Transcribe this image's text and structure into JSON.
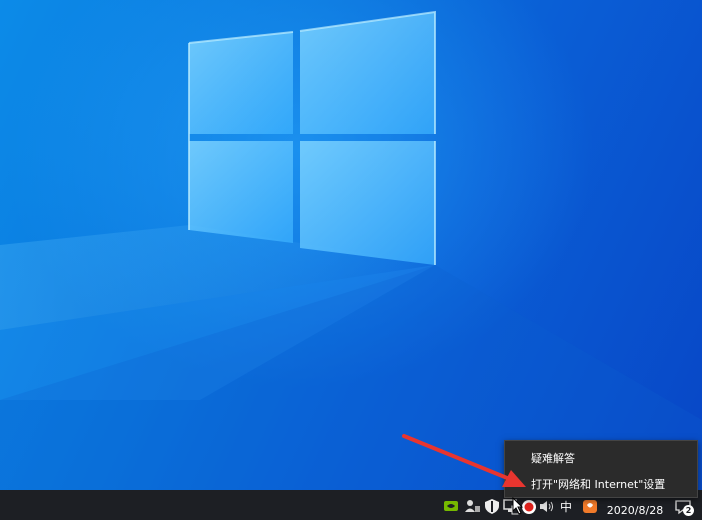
{
  "context_menu": {
    "items": [
      {
        "label": "疑难解答"
      },
      {
        "label": "打开\"网络和 Internet\"设置"
      }
    ]
  },
  "taskbar": {
    "ime_label": "中",
    "date": "2020/8/28",
    "notification_count": "2"
  },
  "tray_icons": [
    "nvidia-icon",
    "network-user-icon",
    "security-shield-icon",
    "network-icon",
    "record-icon",
    "volume-icon",
    "ime-icon",
    "app-icon",
    "notification-icon"
  ],
  "colors": {
    "taskbar": "#1d1f24",
    "menu": "#2b2b2b",
    "annotation_arrow": "#e8352f"
  }
}
